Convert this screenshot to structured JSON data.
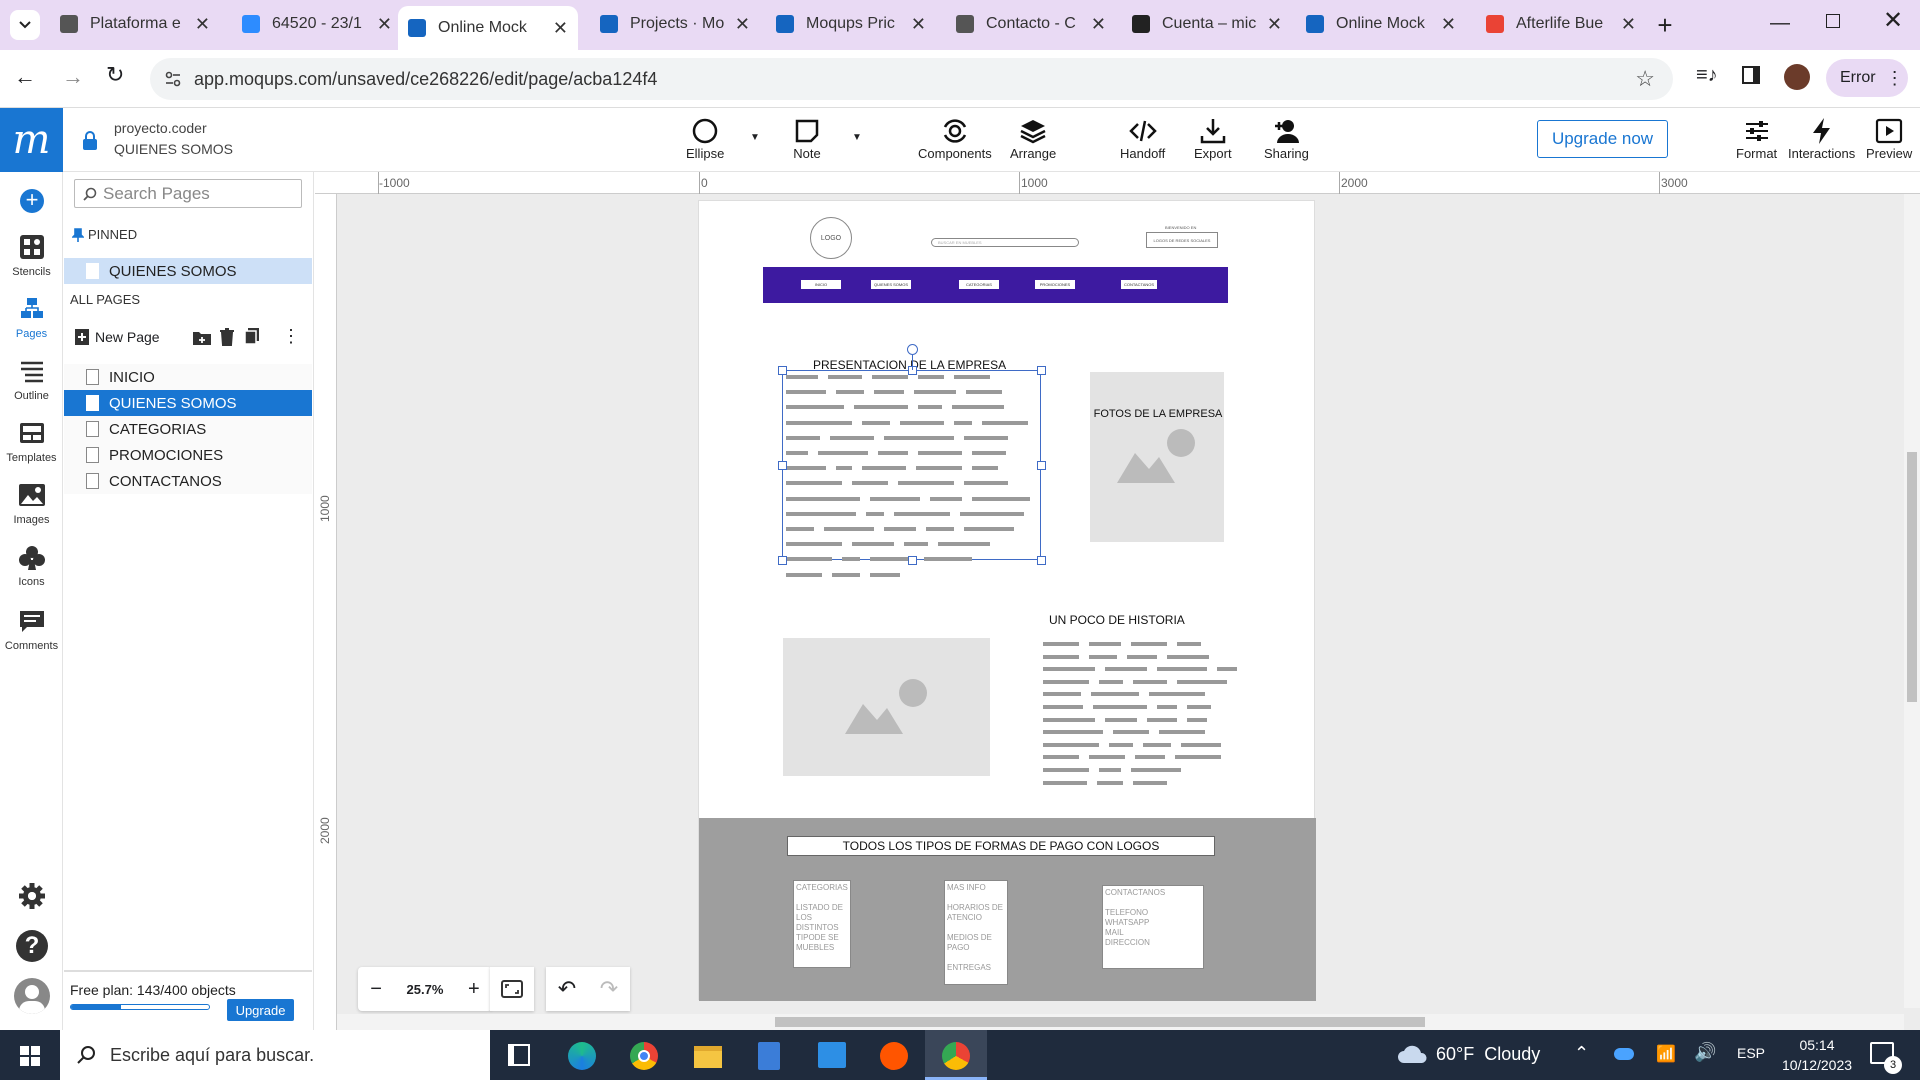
{
  "browser": {
    "tabs": [
      {
        "title": "Plataforma e",
        "color": "#555"
      },
      {
        "title": "64520 - 23/1",
        "color": "#2d8cff"
      },
      {
        "title": "Online Mock",
        "color": "#1565c0"
      },
      {
        "title": "Projects · Mo",
        "color": "#1565c0"
      },
      {
        "title": "Moqups Pric",
        "color": "#1565c0"
      },
      {
        "title": "Contacto - C",
        "color": "#555"
      },
      {
        "title": "Cuenta – mic",
        "color": "#222"
      },
      {
        "title": "Online Mock",
        "color": "#1565c0"
      },
      {
        "title": "Afterlife Bue",
        "color": "#ea4335"
      }
    ],
    "url": "app.moqups.com/unsaved/ce268226/edit/page/acba124f4",
    "profile_label": "Error"
  },
  "app": {
    "project_name": "proyecto.coder",
    "page_name": "QUIENES SOMOS",
    "toolbar": {
      "ellipse": "Ellipse",
      "note": "Note",
      "components": "Components",
      "arrange": "Arrange",
      "handoff": "Handoff",
      "export": "Export",
      "sharing": "Sharing",
      "upgrade": "Upgrade now",
      "format": "Format",
      "interactions": "Interactions",
      "preview": "Preview"
    },
    "rail": {
      "stencils": "Stencils",
      "pages": "Pages",
      "outline": "Outline",
      "templates": "Templates",
      "images": "Images",
      "icons": "Icons",
      "comments": "Comments"
    },
    "pages_panel": {
      "search_placeholder": "Search Pages",
      "pinned_label": "PINNED",
      "pinned_page": "QUIENES SOMOS",
      "all_pages_label": "ALL PAGES",
      "new_page": "New Page",
      "pages": [
        "INICIO",
        "QUIENES SOMOS",
        "CATEGORIAS",
        "PROMOCIONES",
        "CONTACTANOS"
      ],
      "plan_text": "Free plan: 143/400 objects",
      "plan_progress": 0.36,
      "upgrade_btn": "Upgrade"
    },
    "rulers": {
      "h": [
        "-1000",
        "0",
        "1000",
        "2000",
        "3000"
      ],
      "v": [
        "1000",
        "2000"
      ]
    },
    "zoom": "25.7%"
  },
  "mockup": {
    "logo": "LOGO",
    "search_placeholder": "BUSCAR EN MUEBLES",
    "top_right_small": "BIENVENIDO EN",
    "top_right_box": "LOGOS DE REDES SOCIALES",
    "nav": [
      "INICIO",
      "QUIENES SOMOS",
      "CATEGORIAS",
      "PROMOCIONES",
      "CONTACTANOS"
    ],
    "presentation_title": "PRESENTACION DE LA EMPRESA",
    "photos_title": "FOTOS DE LA EMPRESA",
    "history_title": "UN POCO DE HISTORIA",
    "footer_title": "TODOS LOS TIPOS DE FORMAS DE PAGO CON LOGOS",
    "footer_col1": [
      "CATEGORIAS",
      "LISTADO DE LOS DISTINTOS TIPODE SE MUEBLES"
    ],
    "footer_col2": [
      "MAS INFO",
      "HORARIOS DE ATENCIO",
      "MEDIOS DE PAGO",
      "ENTREGAS"
    ],
    "footer_col3": [
      "CONTACTANOS",
      "TELEFONO WHATSAPP MAIL DIRECCION"
    ]
  },
  "taskbar": {
    "search_placeholder": "Escribe aquí para buscar.",
    "weather": "60°F  Cloudy",
    "lang": "ESP",
    "time": "05:14",
    "date": "10/12/2023",
    "notif_count": "3"
  }
}
